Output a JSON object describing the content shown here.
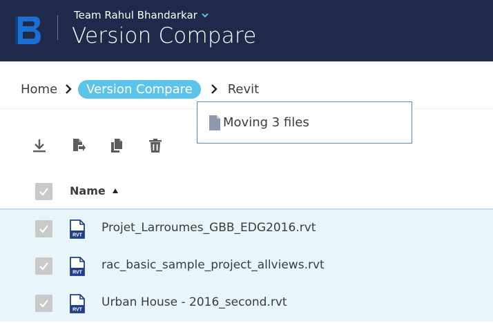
{
  "header": {
    "team_name": "Team Rahul Bhandarkar",
    "app_title": "Version Compare",
    "logo_letter": "B",
    "bg_color": "#1f2a4b"
  },
  "breadcrumb": {
    "items": [
      "Home",
      "Version Compare",
      "Revit"
    ],
    "active_index": 1,
    "active_color": "#5cc3ea"
  },
  "tooltip": {
    "text": "Moving 3 files",
    "icon": "document-icon"
  },
  "toolbar": {
    "buttons": [
      {
        "icon": "download-icon"
      },
      {
        "icon": "move-file-icon"
      },
      {
        "icon": "copy-icon"
      },
      {
        "icon": "trash-icon"
      }
    ]
  },
  "table": {
    "header": {
      "name_label": "Name",
      "sort": "ascending"
    },
    "rows": [
      {
        "name": "Projet_Larroumes_GBB_EDG2016.rvt",
        "type_label": "RVT",
        "checked": true
      },
      {
        "name": "rac_basic_sample_project_allviews.rvt",
        "type_label": "RVT",
        "checked": true
      },
      {
        "name": "Urban House - 2016_second.rvt",
        "type_label": "RVT",
        "checked": true
      }
    ],
    "selected_row_color": "#e8f6fb"
  }
}
